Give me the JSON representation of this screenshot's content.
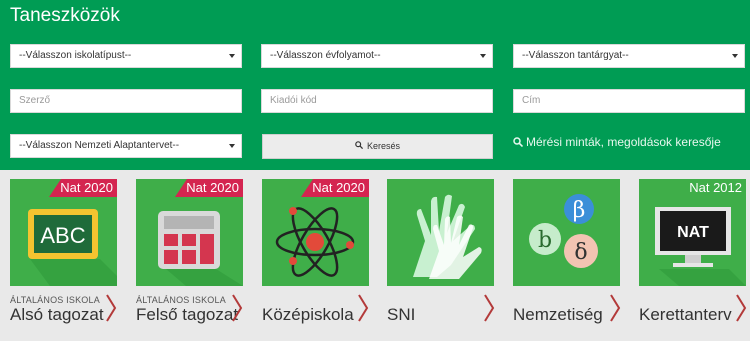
{
  "header": {
    "title": "Taneszközök"
  },
  "filters": {
    "school_type": "--Válasszon iskolatípust--",
    "grade": "--Válasszon évfolyamot--",
    "subject": "--Válasszon tantárgyat--",
    "author_placeholder": "Szerző",
    "publisher_code_placeholder": "Kiadói kód",
    "title_placeholder": "Cím",
    "nat": "--Válasszon Nemzeti Alaptantervet--",
    "search_label": "Keresés",
    "results_link": "Mérési minták, megoldások keresője"
  },
  "categories": [
    {
      "badge": "Nat 2020",
      "small": "ÁLTALÁNOS ISKOLA",
      "label": "Alsó tagozat",
      "icon": "abc-board-icon"
    },
    {
      "badge": "Nat 2020",
      "small": "ÁLTALÁNOS ISKOLA",
      "label": "Felső tagozat",
      "icon": "calculator-icon"
    },
    {
      "badge": "Nat 2020",
      "small": "",
      "label": "Középiskola",
      "icon": "atom-icon"
    },
    {
      "badge": "",
      "small": "",
      "label": "SNI",
      "icon": "hands-icon"
    },
    {
      "badge": "",
      "small": "",
      "label": "Nemzetiség",
      "icon": "greek-letters-icon"
    },
    {
      "badge": "Nat 2012",
      "small": "",
      "label": "Kerettanterv",
      "icon": "monitor-nat-icon"
    }
  ],
  "icon_texts": {
    "abc": "ABC",
    "beta": "β",
    "b": "b",
    "delta": "δ",
    "nat": "NAT"
  },
  "colors": {
    "panel": "#009c54",
    "tile": "#3fae49",
    "badge": "#d42550",
    "chevron": "#b33a3a"
  }
}
